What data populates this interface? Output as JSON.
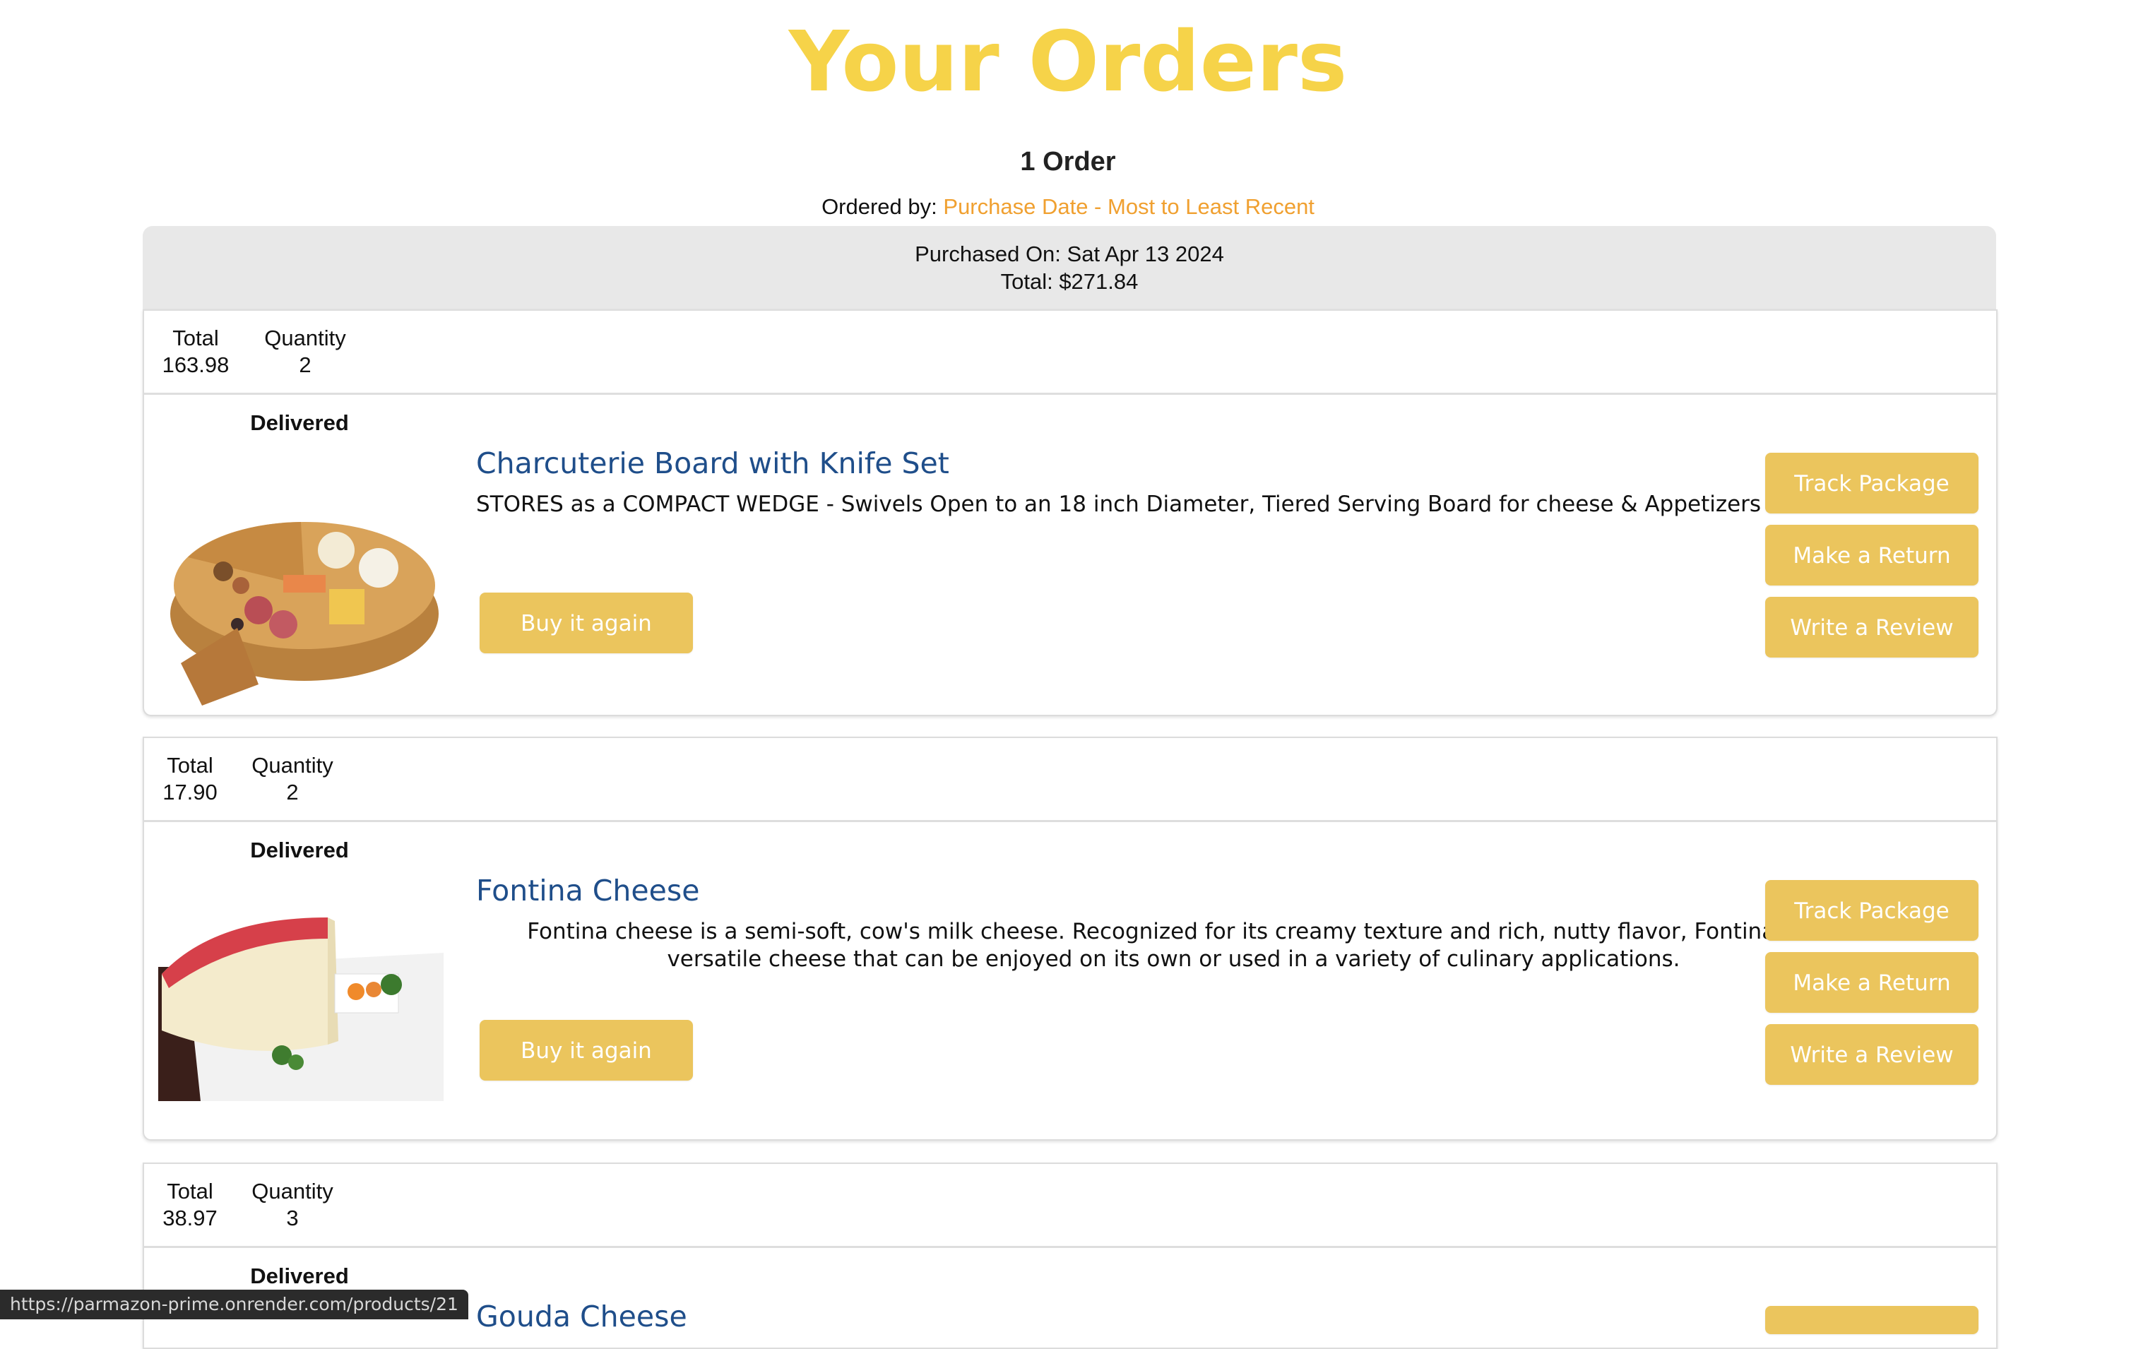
{
  "page": {
    "title": "Your Orders",
    "order_count": "1 Order",
    "ordered_by_label": "Ordered by:",
    "ordered_by_value": "Purchase Date - Most to Least Recent"
  },
  "order": {
    "purchased_on": "Purchased On: Sat Apr 13 2024",
    "total": "Total: $271.84"
  },
  "labels": {
    "total": "Total",
    "quantity": "Quantity",
    "buy_again": "Buy it again",
    "track_package": "Track Package",
    "make_return": "Make a Return",
    "write_review": "Write a Review"
  },
  "items": [
    {
      "total": "163.98",
      "quantity": "2",
      "status": "Delivered",
      "title": "Charcuterie Board with Knife Set",
      "description": "STORES as a COMPACT WEDGE - Swivels Open to an 18 inch Diameter, Tiered Serving Board for cheese & Appetizers",
      "image_icon": "charcuterie-board-image"
    },
    {
      "total": "17.90",
      "quantity": "2",
      "status": "Delivered",
      "title": "Fontina Cheese",
      "description": "Fontina cheese is a semi-soft, cow's milk cheese. Recognized for its creamy texture and rich, nutty flavor, Fontina is a versatile cheese that can be enjoyed on its own or used in a variety of culinary applications.",
      "image_icon": "fontina-cheese-image"
    },
    {
      "total": "38.97",
      "quantity": "3",
      "status": "Delivered",
      "title": "Gouda Cheese"
    }
  ],
  "status_bar": {
    "url": "https://parmazon-prime.onrender.com/products/21"
  },
  "colors": {
    "title": "#f6d349",
    "button": "#ebc55d",
    "link": "#1f4e8a",
    "sort_link": "#f0a030"
  }
}
